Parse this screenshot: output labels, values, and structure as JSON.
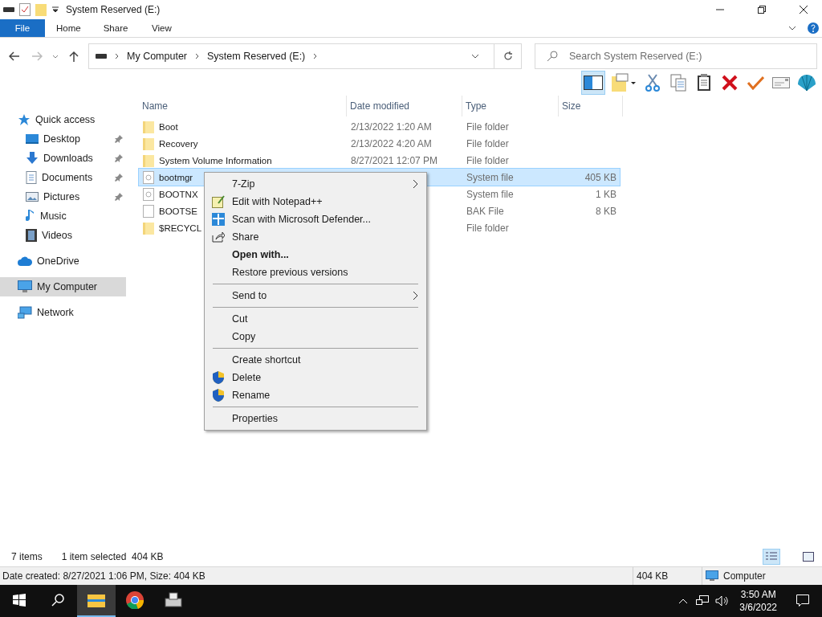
{
  "window": {
    "title": "System Reserved (E:)"
  },
  "ribbon_tabs": [
    {
      "label": "File",
      "selected": true
    },
    {
      "label": "Home",
      "selected": false
    },
    {
      "label": "Share",
      "selected": false
    },
    {
      "label": "View",
      "selected": false
    }
  ],
  "address": {
    "crumbs": [
      "My Computer",
      "System Reserved (E:)"
    ]
  },
  "search": {
    "placeholder": "Search System Reserved (E:)"
  },
  "toolbar_buttons": [
    {
      "kind": "pane",
      "selected": true
    },
    {
      "kind": "notes",
      "selected": false
    },
    {
      "kind": "cut",
      "selected": false
    },
    {
      "kind": "copy",
      "selected": false
    },
    {
      "kind": "paste",
      "selected": false
    },
    {
      "kind": "delete",
      "selected": false
    },
    {
      "kind": "check",
      "selected": false
    },
    {
      "kind": "card",
      "selected": false
    },
    {
      "kind": "shell",
      "selected": false
    }
  ],
  "sidebar": {
    "items": [
      {
        "label": "Quick access",
        "kind": "star",
        "selected": false,
        "children": [
          {
            "label": "Desktop",
            "kind": "desktop",
            "pinned": true,
            "selected": false
          },
          {
            "label": "Downloads",
            "kind": "downloads",
            "pinned": true,
            "selected": false
          },
          {
            "label": "Documents",
            "kind": "documents",
            "pinned": true,
            "selected": false
          },
          {
            "label": "Pictures",
            "kind": "pictures",
            "pinned": true,
            "selected": false
          },
          {
            "label": "Music",
            "kind": "music",
            "pinned": false,
            "selected": false
          },
          {
            "label": "Videos",
            "kind": "videos",
            "pinned": false,
            "selected": false
          }
        ]
      },
      {
        "label": "OneDrive",
        "kind": "cloud",
        "selected": false
      },
      {
        "label": "My Computer",
        "kind": "computer",
        "selected": true
      },
      {
        "label": "Network",
        "kind": "network",
        "selected": false
      }
    ]
  },
  "table": {
    "columns": [
      "Name",
      "Date modified",
      "Type",
      "Size"
    ],
    "rows": [
      {
        "kind": "folder",
        "name": "Boot",
        "date": "2/13/2022 1:20 AM",
        "type": "File folder",
        "selected": false
      },
      {
        "kind": "folder",
        "name": "Recovery",
        "date": "2/13/2022 4:20 AM",
        "type": "File folder",
        "selected": false
      },
      {
        "kind": "folder",
        "name": "System Volume Information",
        "date": "8/27/2021 12:07 PM",
        "type": "File folder",
        "selected": false
      },
      {
        "kind": "system",
        "name": "bootmgr",
        "type": "System file",
        "size": "405 KB",
        "selected": true
      },
      {
        "kind": "system",
        "name": "BOOTNX",
        "type": "System file",
        "size": "1 KB",
        "selected": false
      },
      {
        "kind": "file",
        "name": "BOOTSE",
        "type": "BAK File",
        "size": "8 KB",
        "selected": false
      },
      {
        "kind": "folder",
        "name": "$RECYCL",
        "type": "File folder",
        "selected": false
      }
    ]
  },
  "context_menu": [
    {
      "kind": "plain",
      "label": "7-Zip",
      "submenu": true,
      "bold": false
    },
    {
      "kind": "notepad",
      "label": "Edit with Notepad++",
      "submenu": false,
      "bold": false
    },
    {
      "kind": "defender",
      "label": "Scan with Microsoft Defender...",
      "submenu": false,
      "bold": false
    },
    {
      "kind": "share",
      "label": "Share",
      "submenu": false,
      "bold": false
    },
    {
      "kind": "plain",
      "label": "Open with...",
      "submenu": false,
      "bold": true
    },
    {
      "kind": "plain",
      "label": "Restore previous versions",
      "submenu": false,
      "bold": false
    },
    {
      "kind": "separator"
    },
    {
      "kind": "plain",
      "label": "Send to",
      "submenu": true,
      "bold": false
    },
    {
      "kind": "separator"
    },
    {
      "kind": "plain",
      "label": "Cut",
      "submenu": false,
      "bold": false
    },
    {
      "kind": "plain",
      "label": "Copy",
      "submenu": false,
      "bold": false
    },
    {
      "kind": "separator"
    },
    {
      "kind": "plain",
      "label": "Create shortcut",
      "submenu": false,
      "bold": false
    },
    {
      "kind": "uac",
      "label": "Delete",
      "submenu": false,
      "bold": false
    },
    {
      "kind": "uac",
      "label": "Rename",
      "submenu": false,
      "bold": false
    },
    {
      "kind": "separator"
    },
    {
      "kind": "plain",
      "label": "Properties",
      "submenu": false,
      "bold": false
    }
  ],
  "status_bar": {
    "items_count": "7 items",
    "selection": "1 item selected  404 KB"
  },
  "details_bar": {
    "info": "Date created: 8/27/2021 1:06 PM, Size: 404 KB",
    "size": "404 KB",
    "location": "Computer"
  },
  "taskbar": {
    "apps": [
      {
        "kind": "explorer",
        "active": true
      },
      {
        "kind": "browser",
        "active": false
      },
      {
        "kind": "drive",
        "active": false
      }
    ],
    "time": "3:50 AM",
    "date": "3/6/2022"
  }
}
